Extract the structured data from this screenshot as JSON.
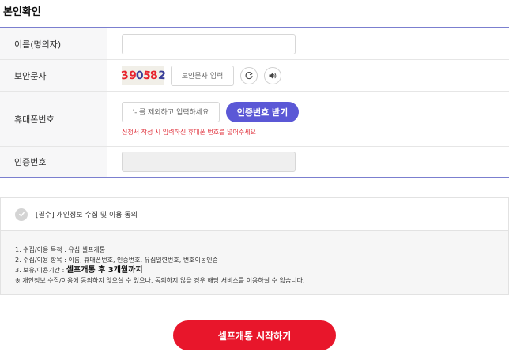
{
  "page": {
    "title": "본인확인"
  },
  "form": {
    "name": {
      "label": "이름(명의자)",
      "value": ""
    },
    "captcha": {
      "label": "보안문자",
      "code": [
        "3",
        "9",
        "0",
        "5",
        "8",
        "2"
      ],
      "input_label": "보안문자 입력",
      "refresh_icon": "refresh-icon",
      "audio_icon": "speaker-icon"
    },
    "phone": {
      "label": "휴대폰번호",
      "placeholder": "'-'를 제외하고 입력하세요",
      "send_button": "인증번호 받기",
      "note": "신청서 작성 시 입력하신 휴대폰 번호를 넣어주세요"
    },
    "cert": {
      "label": "인증번호",
      "value": ""
    }
  },
  "agreement": {
    "checkbox_label": "[필수] 개인정보 수집 및 이용 동의",
    "lines": {
      "purpose": "1. 수집/이용 목적 : 유심 셀프개통",
      "items": "2. 수집/이용 항목 : 이름, 휴대폰번호, 인증번호, 유심일련번호, 번호이동인증",
      "period_prefix": "3. 보유/이용기간 : ",
      "period_value": "셀프개통 후 3개월까지",
      "notice": "※ 개인정보 수집/이용에 동의하지 않으실 수 있으나, 동의하지 않을 경우 해당 서비스를 이용하실 수 없습니다."
    }
  },
  "submit": {
    "label": "셀프개통 시작하기"
  },
  "colors": {
    "accent": "#5b58d6",
    "primary": "#e8162b",
    "border": "#7b7fcf",
    "note": "#e0323c"
  }
}
